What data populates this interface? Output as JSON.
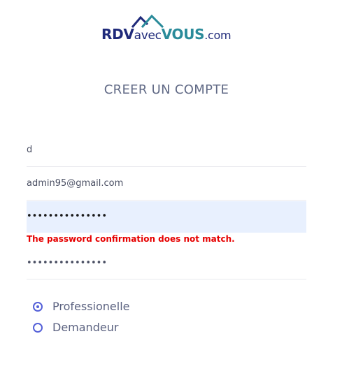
{
  "logo": {
    "part1": "RDV",
    "part2": "avec",
    "part3": "VOUS",
    "part4": ".com"
  },
  "page_title": "CREER UN COMPTE",
  "form": {
    "name_value": "d",
    "email_value": "admin95@gmail.com",
    "password_value": "•••••••••••••••",
    "error_message": "The password confirmation does not match.",
    "password_confirm_value": "•••••••••••••••",
    "radios": [
      {
        "label": "Professionelle",
        "checked": true
      },
      {
        "label": "Demandeur",
        "checked": false
      }
    ]
  },
  "colors": {
    "brand_dark": "#1f2a7a",
    "brand_teal": "#2a8b9a",
    "error": "#e60000",
    "autofill_bg": "#e8f0fe",
    "radio_accent": "#5460d8"
  }
}
